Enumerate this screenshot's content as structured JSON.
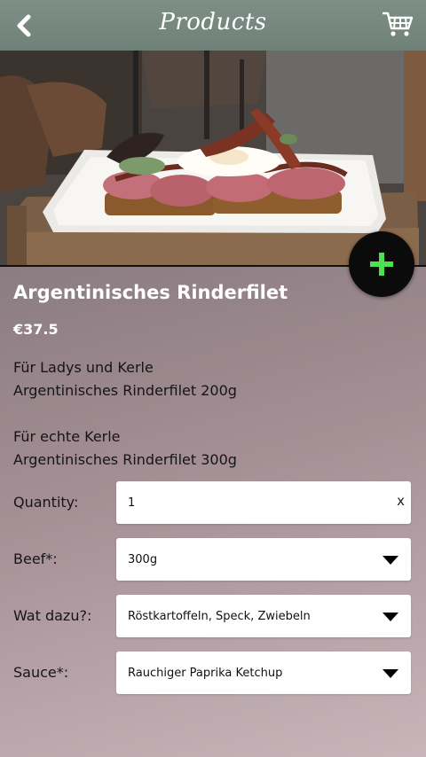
{
  "header": {
    "title": "Products",
    "back_icon": "chevron-left-icon",
    "cart_icon": "shopping-cart-icon"
  },
  "product": {
    "name": "Argentinisches Rinderfilet",
    "price": "€37.5",
    "description": [
      "Für Ladys und Kerle",
      "Argentinisches Rinderfilet 200g",
      "",
      "Für echte Kerle",
      "Argentinisches Rinderfilet 300g"
    ]
  },
  "form": {
    "quantity": {
      "label": "Quantity:",
      "value": "1",
      "clear": "x"
    },
    "beef": {
      "label": "Beef*:",
      "value": "300g"
    },
    "sides": {
      "label": "Wat dazu?:",
      "value": "Röstkartoffeln, Speck, Zwiebeln"
    },
    "sauce": {
      "label": "Sauce*:",
      "value": "Rauchiger Paprika Ketchup"
    }
  },
  "colors": {
    "header_bg": "#6f8178",
    "add_button": "#0b0b0b",
    "add_icon": "#4ee04e"
  }
}
